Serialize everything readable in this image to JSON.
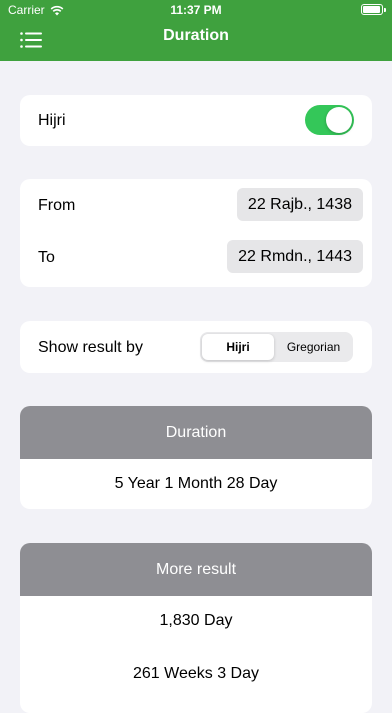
{
  "status_bar": {
    "carrier": "Carrier",
    "time": "11:37 PM"
  },
  "nav": {
    "title": "Duration"
  },
  "hijri_toggle": {
    "label": "Hijri",
    "on": true
  },
  "date_range": {
    "from_label": "From",
    "from_value": "22 Rajb., 1438",
    "to_label": "To",
    "to_value": "22 Rmdn., 1443"
  },
  "result_by": {
    "label": "Show result by",
    "options": [
      "Hijri",
      "Gregorian"
    ],
    "selected": "Hijri"
  },
  "duration": {
    "header": "Duration",
    "value": "5 Year 1 Month 28 Day"
  },
  "more_result": {
    "header": "More result",
    "lines": [
      "1,830 Day",
      "261 Weeks 3 Day"
    ]
  },
  "colors": {
    "accent_green": "#3fa13e",
    "toggle_green": "#34c759",
    "header_gray": "#8e8e93",
    "background": "#f2f2f7"
  }
}
